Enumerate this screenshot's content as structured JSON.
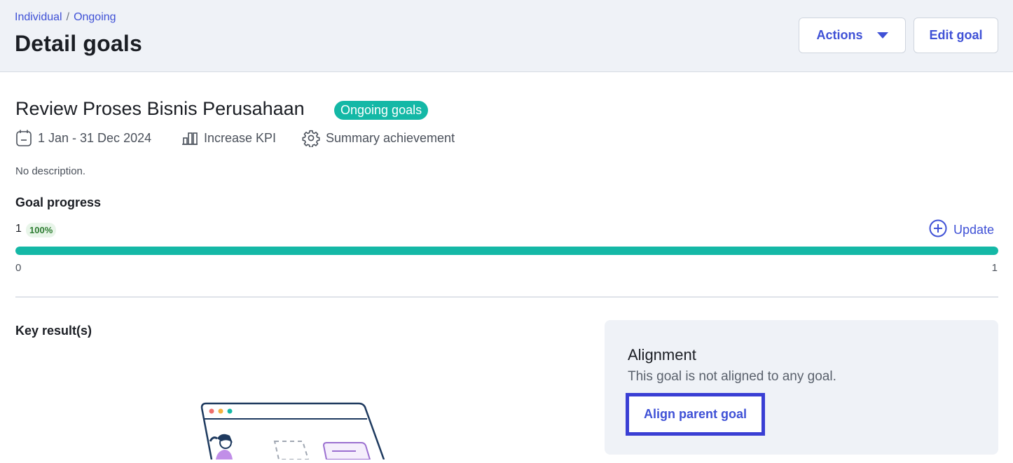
{
  "breadcrumb": {
    "items": [
      "Individual",
      "Ongoing"
    ],
    "separator": "/"
  },
  "header": {
    "title": "Detail goals",
    "actions_label": "Actions",
    "edit_label": "Edit goal"
  },
  "goal": {
    "title": "Review Proses Bisnis Perusahaan",
    "status": "Ongoing goals",
    "period": "1 Jan - 31 Dec 2024",
    "type": "Increase KPI",
    "method": "Summary achievement",
    "description": "No description."
  },
  "progress": {
    "heading": "Goal progress",
    "current": "1",
    "percent_label": "100%",
    "fraction": 1.0,
    "min": "0",
    "max": "1",
    "update_label": "Update"
  },
  "key_results": {
    "heading": "Key result(s)"
  },
  "alignment": {
    "heading": "Alignment",
    "text": "This goal is not aligned to any goal.",
    "button_label": "Align parent goal"
  },
  "icons": {
    "calendar": "calendar-icon",
    "chart": "bar-chart-icon",
    "gear": "gear-icon",
    "plus": "plus-circle-icon",
    "caret": "chevron-down-icon"
  },
  "colors": {
    "accent": "#3f51d6",
    "teal": "#14b8a6",
    "header_bg": "#eff2f7",
    "highlight": "#3a3fd4"
  }
}
